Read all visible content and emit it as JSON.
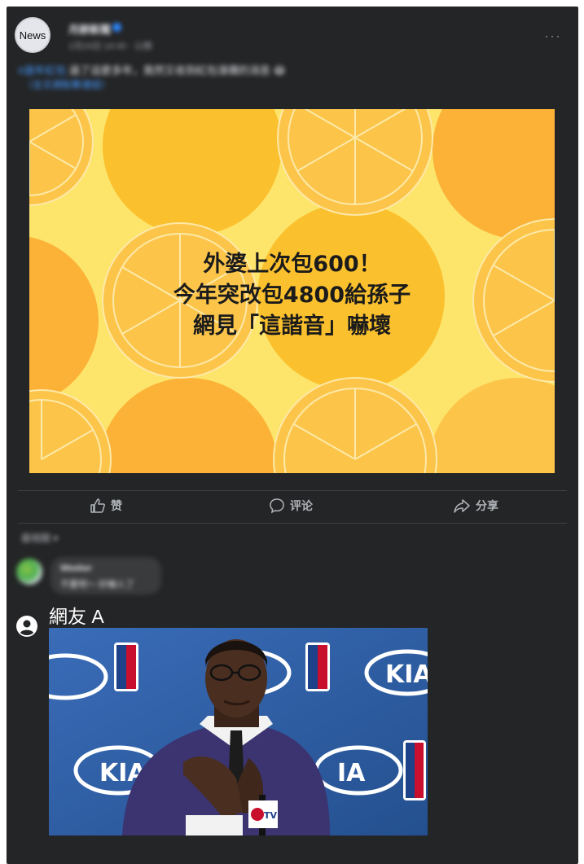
{
  "post": {
    "avatar_text": "News",
    "page_name": "月餅新聞",
    "meta": "1月24日 14:40 · 公開",
    "more_icon": "more-horizontal-icon",
    "body_hashtag": "#過年紅包",
    "body_text": " 過了這麼多年，竟然又收到紅包漲價的消息 😂",
    "body_link": "（全文請點擊連結）"
  },
  "banner": {
    "lines": [
      "外婆上次包600！",
      "今年突改包4800給孫子",
      "網見「這諧音」嚇壞"
    ],
    "colors": {
      "background": "#fde56b",
      "orange": "#fbb237",
      "orange_light": "#fcc54a",
      "line": "#fde9a9"
    }
  },
  "actions": [
    {
      "label": "赞",
      "icon": "thumbs-up-icon"
    },
    {
      "label": "评论",
      "icon": "comment-icon"
    },
    {
      "label": "分享",
      "icon": "share-icon"
    }
  ],
  "comments": {
    "sort_label": "最相關 ▾",
    "first": {
      "name": "Weeker",
      "text": "不要吧～ 好嚇人了"
    },
    "reply": {
      "name": "網友 A",
      "user_icon": "person-circle-icon",
      "photo": "crying-man-press-conference-photo"
    }
  },
  "colors": {
    "panel": "#242526",
    "text": "#e4e6eb",
    "muted": "#b0b3b8",
    "link": "#4599ff"
  }
}
